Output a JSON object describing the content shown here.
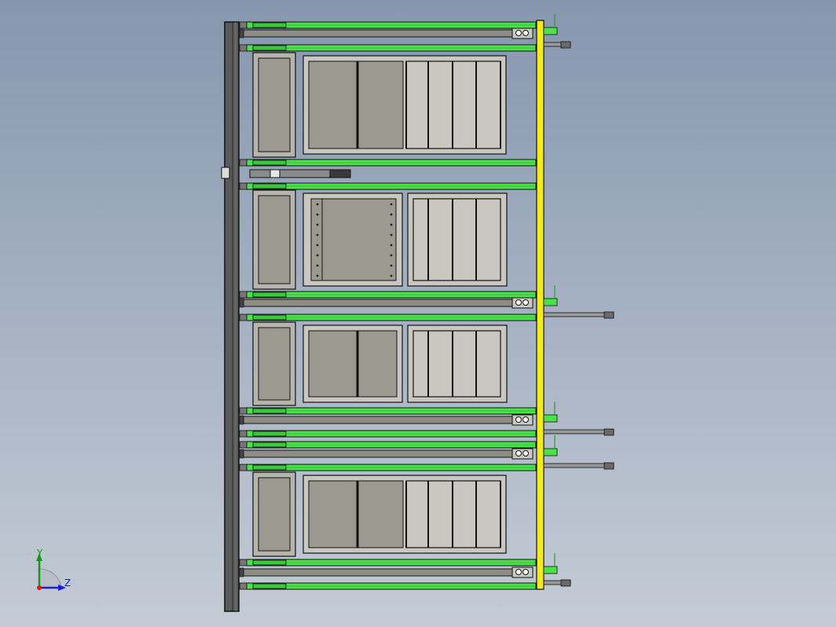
{
  "view": {
    "background_top": "#8696ad",
    "background_bottom": "#c4cbd5"
  },
  "colors": {
    "frame_green": "#4be14b",
    "frame_green_dark": "#2a8c2a",
    "yellow_post": "#f2ec1a",
    "panel_gray": "#9a9a90",
    "steel_dark": "#4a4a4a",
    "steel_mid": "#8a8a8a",
    "outline": "#111111"
  },
  "triad": {
    "y_label": "Y",
    "z_label": "Z",
    "icon": "view-orientation-triad-icon"
  }
}
